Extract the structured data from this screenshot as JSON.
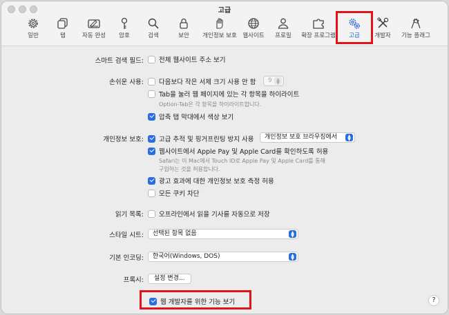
{
  "window": {
    "title": "고급"
  },
  "toolbar": {
    "items": [
      {
        "label": "일반",
        "icon": "gear-icon"
      },
      {
        "label": "탭",
        "icon": "tabs-icon"
      },
      {
        "label": "자동 완성",
        "icon": "autofill-icon"
      },
      {
        "label": "암호",
        "icon": "key-icon"
      },
      {
        "label": "검색",
        "icon": "search-icon"
      },
      {
        "label": "보안",
        "icon": "lock-icon"
      },
      {
        "label": "개인정보 보호",
        "icon": "hand-icon"
      },
      {
        "label": "웹사이트",
        "icon": "globe-icon"
      },
      {
        "label": "프로필",
        "icon": "person-icon"
      },
      {
        "label": "확장 프로그램",
        "icon": "puzzle-icon"
      },
      {
        "label": "고급",
        "icon": "gears-icon",
        "active": true
      },
      {
        "label": "개발자",
        "icon": "tools-icon"
      },
      {
        "label": "기능 플래그",
        "icon": "flags-icon"
      }
    ],
    "accent": "#1b62d6"
  },
  "settings": {
    "smart_search": {
      "label": "스마트 검색 필드:",
      "show_full_address": {
        "text": "전체 웹사이트 주소 보기",
        "checked": false
      }
    },
    "accessibility": {
      "label": "손쉬운 사용:",
      "min_font": {
        "text": "다음보다 작은 서체 크기 사용 안 함",
        "checked": false,
        "value": "9"
      },
      "tab_highlight": {
        "text": "Tab을 눌러 웹 페이지에 있는 각 항목을 하이라이트",
        "checked": false
      },
      "tab_hint": "Option-Tab은 각 항목을 하이라이트합니다.",
      "compact_tab_color": {
        "text": "압축 탭 막대에서 색상 보기",
        "checked": true
      }
    },
    "privacy": {
      "label": "개인정보 보호:",
      "advanced_tracking": {
        "text": "고급 추적 및 핑거프린팅 방지 사용",
        "checked": true
      },
      "tracking_select": "개인정보 보호 브라우징에서",
      "apple_pay": {
        "text": "웹사이트에서 Apple Pay 및 Apple Card를 확인하도록 허용",
        "checked": true
      },
      "apple_pay_hint_1": "Safari는 이 Mac에서 Touch ID로 Apple Pay 및 Apple Card를 통해",
      "apple_pay_hint_2": "구입하는 것을 허용합니다.",
      "ad_measurement": {
        "text": "광고 효과에 대한 개인정보 보호 측정 허용",
        "checked": true
      },
      "block_cookies": {
        "text": "모든 쿠키 차단",
        "checked": false
      }
    },
    "reading_list": {
      "label": "읽기 목록:",
      "offline": {
        "text": "오프라인에서 읽을 기사를 자동으로 저장",
        "checked": false
      }
    },
    "style_sheet": {
      "label": "스타일 시트:",
      "value": "선택된 항목 없음"
    },
    "encoding": {
      "label": "기본 인코딩:",
      "value": "한국어(Windows, DOS)"
    },
    "proxy": {
      "label": "프록시:",
      "button": "설정 변경..."
    },
    "developer": {
      "text": "웹 개발자를 위한 기능 보기",
      "checked": true
    }
  },
  "help": "?"
}
